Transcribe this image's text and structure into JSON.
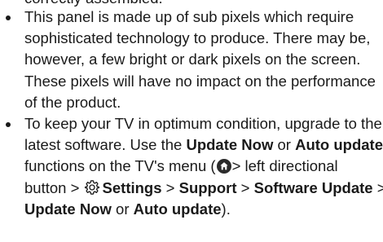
{
  "top_cut_line": "correctly assembled.",
  "bullets": [
    {
      "lines": [
        "This panel is made up of sub pixels which require",
        "sophisticated technology to produce. There may be,",
        "however, a few bright or dark pixels on the screen.",
        "These pixels will have no impact on the performance",
        "of the product."
      ]
    },
    {
      "line1": "To keep your TV in optimum condition, upgrade to the",
      "line2": "latest software. Use the",
      "update_now": "Update Now",
      "or": "or",
      "auto_update": "Auto update",
      "line3_start": "functions on the TV's menu (",
      "line3_end": "> left directional",
      "line4_start": "button >",
      "settings": "Settings",
      "sep": ">",
      "support": "Support",
      "software_update": "Software Update",
      "close": ")."
    }
  ],
  "icons": [
    "home-icon",
    "gear-icon"
  ]
}
